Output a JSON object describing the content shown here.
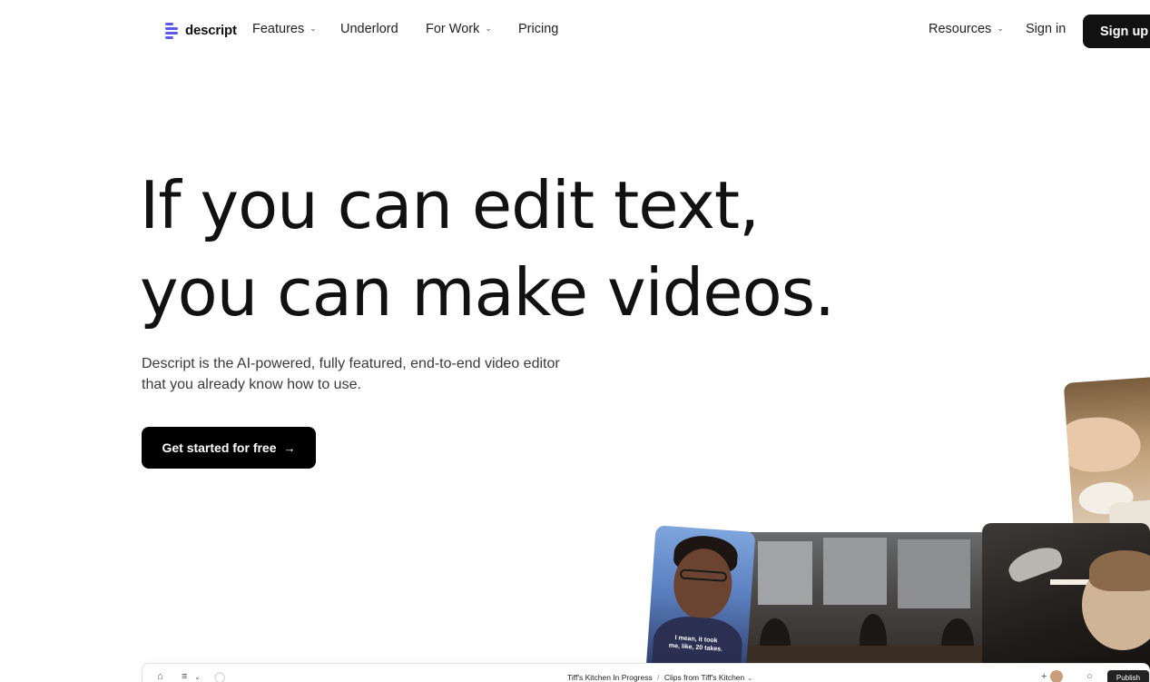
{
  "nav": {
    "logo_text": "descript",
    "items": [
      {
        "label": "Features",
        "has_dropdown": true
      },
      {
        "label": "Underlord",
        "has_dropdown": false
      },
      {
        "label": "For Work",
        "has_dropdown": true
      },
      {
        "label": "Pricing",
        "has_dropdown": false
      }
    ],
    "resources": {
      "label": "Resources",
      "has_dropdown": true
    },
    "sign_in": "Sign in",
    "sign_up": "Sign up",
    "brand_color": "#5b5bf0"
  },
  "hero": {
    "headline_line1": "If you can edit text,",
    "headline_line2": "you can make videos.",
    "subtitle_line1": "Descript is the AI-powered, fully featured, end-to-end video editor",
    "subtitle_line2": "that you already know how to use.",
    "cta_label": "Get started for free",
    "cta_icon": "arrow-right-icon"
  },
  "preview": {
    "caption_line1": "I mean, it took",
    "caption_line2": "me, like, 20 takes.",
    "app_title": "Tiff's Kitchen In Progress",
    "breadcrumb_sep": "/",
    "app_subtitle": "Clips from Tiff's Kitchen",
    "publish_label": "Publish"
  }
}
